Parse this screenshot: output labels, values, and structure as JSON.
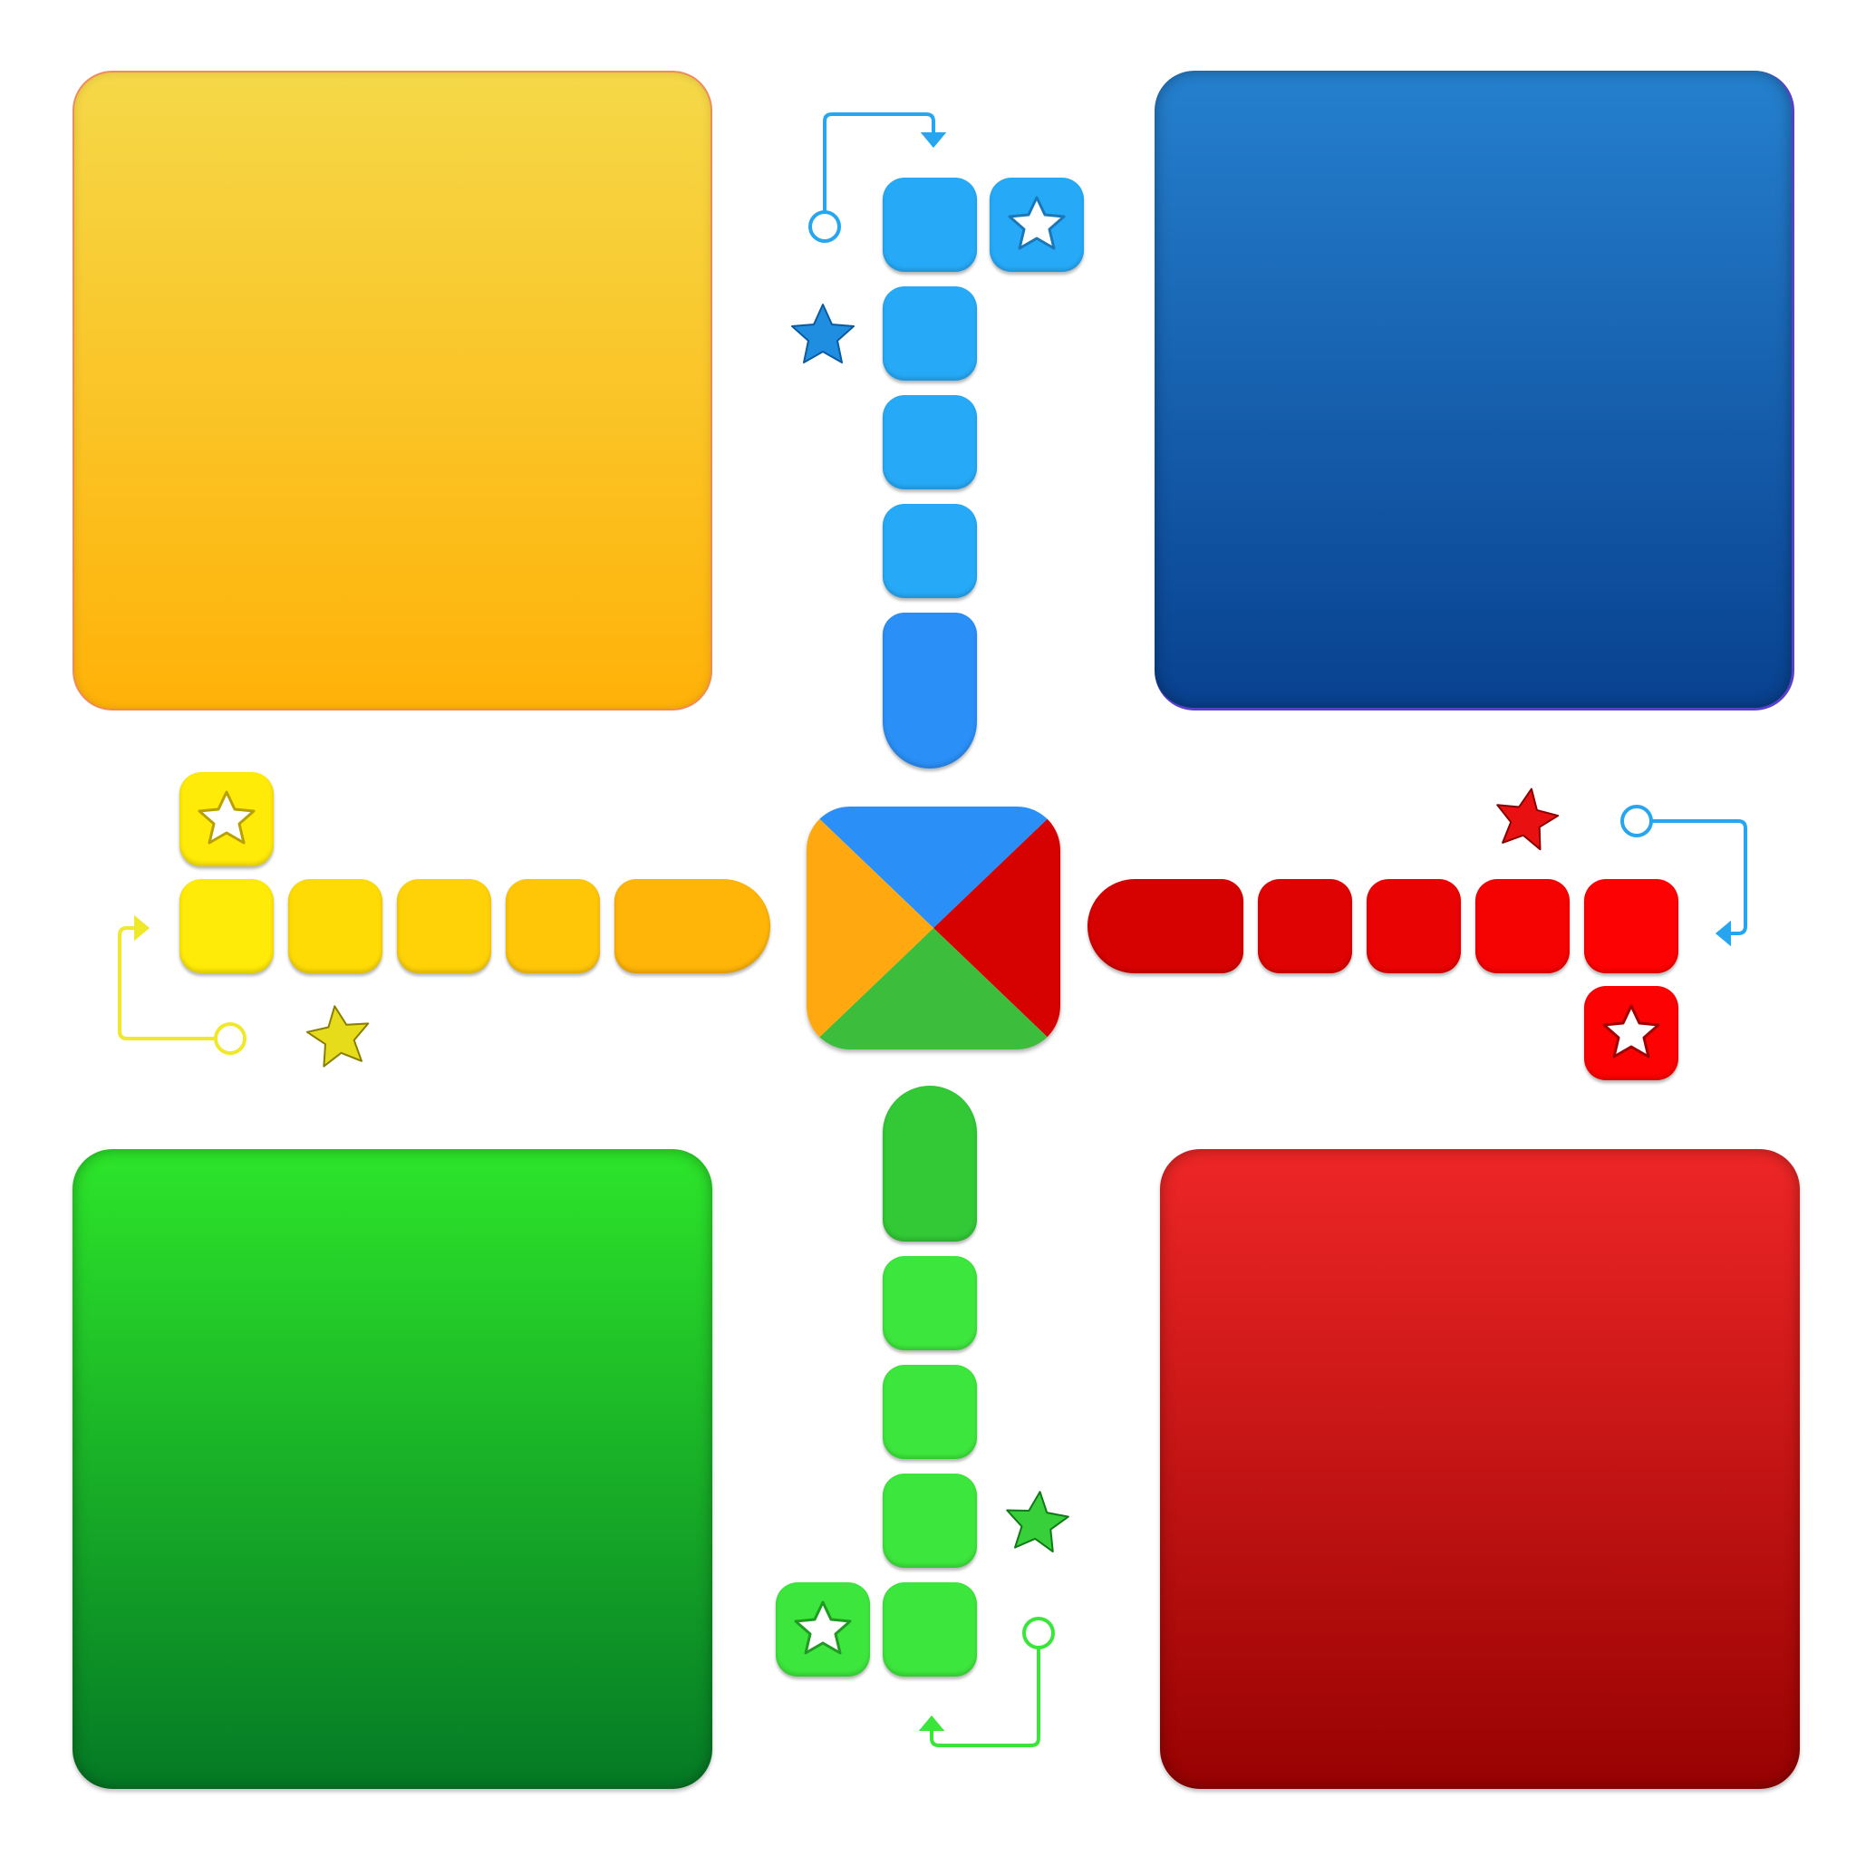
{
  "board": {
    "players": [
      {
        "color_name": "yellow",
        "home_gradient": [
          "#f5d848",
          "#ffb208"
        ]
      },
      {
        "color_name": "blue",
        "home_gradient": [
          "#2580ce",
          "#08418f"
        ]
      },
      {
        "color_name": "green",
        "home_gradient": [
          "#2de52a",
          "#057a25"
        ]
      },
      {
        "color_name": "red",
        "home_gradient": [
          "#ee2626",
          "#980202"
        ]
      }
    ],
    "center_colors": {
      "top": "#2a8ff7",
      "right": "#d60202",
      "bottom": "#3cbd3b",
      "left": "#ffa80f"
    },
    "path_cells_per_arm": 5,
    "safe_squares": [
      "yellow-start",
      "blue-start",
      "red-start",
      "green-start"
    ],
    "icons": {
      "star": "star-icon",
      "arrow": "entry-arrow-icon"
    }
  }
}
